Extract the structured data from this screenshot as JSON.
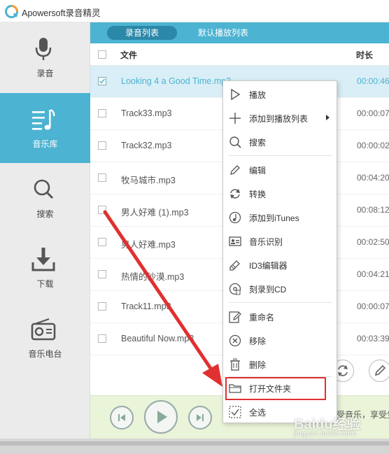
{
  "app": {
    "title": "Apowersoft录音精灵"
  },
  "sidebar": {
    "items": [
      {
        "label": "录音",
        "icon": "microphone-icon"
      },
      {
        "label": "音乐库",
        "icon": "music-library-icon",
        "active": true
      },
      {
        "label": "搜索",
        "icon": "search-icon"
      },
      {
        "label": "下载",
        "icon": "download-icon"
      },
      {
        "label": "音乐电台",
        "icon": "radio-icon"
      }
    ]
  },
  "tabs": [
    {
      "label": "录音列表",
      "active": true
    },
    {
      "label": "默认播放列表",
      "active": false
    }
  ],
  "list": {
    "header_file": "文件",
    "header_duration": "时长",
    "rows": [
      {
        "name": "Looking 4 a Good Time.mp3",
        "duration": "00:00:46",
        "selected": true
      },
      {
        "name": "Track33.mp3",
        "duration": "00:00:07"
      },
      {
        "name": "Track32.mp3",
        "duration": "00:00:02"
      },
      {
        "name": "牧马城市.mp3",
        "duration": "00:04:20"
      },
      {
        "name": "男人好难 (1).mp3",
        "duration": "00:08:12"
      },
      {
        "name": "男人好难.mp3",
        "duration": "00:02:50"
      },
      {
        "name": "热情的沙漠.mp3",
        "duration": "00:04:21"
      },
      {
        "name": "Track11.mp3",
        "duration": "00:00:07"
      },
      {
        "name": "Beautiful Now.mp3",
        "duration": "00:03:39"
      }
    ]
  },
  "context_menu": {
    "items": [
      {
        "label": "播放",
        "icon": "play-icon"
      },
      {
        "label": "添加到播放列表",
        "icon": "plus-icon",
        "submenu": true
      },
      {
        "label": "搜索",
        "icon": "search-icon"
      },
      {
        "label": "编辑",
        "icon": "pencil-icon"
      },
      {
        "label": "转换",
        "icon": "convert-icon"
      },
      {
        "label": "添加到iTunes",
        "icon": "itunes-icon"
      },
      {
        "label": "音乐识别",
        "icon": "id-card-icon"
      },
      {
        "label": "ID3编辑器",
        "icon": "tag-edit-icon"
      },
      {
        "label": "刻录到CD",
        "icon": "cd-icon"
      },
      {
        "label": "重命名",
        "icon": "rename-icon"
      },
      {
        "label": "移除",
        "icon": "remove-icon"
      },
      {
        "label": "删除",
        "icon": "trash-icon"
      },
      {
        "label": "打开文件夹",
        "icon": "folder-icon",
        "highlighted": true
      },
      {
        "label": "全选",
        "icon": "select-all-icon"
      }
    ]
  },
  "player": {
    "promo_text": "受音乐，享受生"
  },
  "watermark": {
    "text": "Baidu经验",
    "sub": "jingyan.baidu.com"
  },
  "colors": {
    "accent": "#4cb3d2",
    "highlight_border": "#e03030",
    "arrow": "#e03030"
  }
}
